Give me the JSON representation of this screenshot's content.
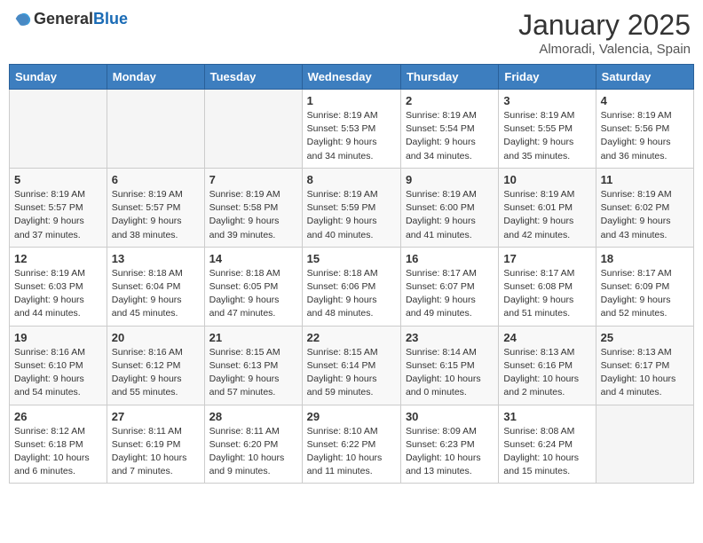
{
  "header": {
    "logo_general": "General",
    "logo_blue": "Blue",
    "month_year": "January 2025",
    "location": "Almoradi, Valencia, Spain"
  },
  "weekdays": [
    "Sunday",
    "Monday",
    "Tuesday",
    "Wednesday",
    "Thursday",
    "Friday",
    "Saturday"
  ],
  "weeks": [
    [
      {
        "day": "",
        "info": ""
      },
      {
        "day": "",
        "info": ""
      },
      {
        "day": "",
        "info": ""
      },
      {
        "day": "1",
        "info": "Sunrise: 8:19 AM\nSunset: 5:53 PM\nDaylight: 9 hours\nand 34 minutes."
      },
      {
        "day": "2",
        "info": "Sunrise: 8:19 AM\nSunset: 5:54 PM\nDaylight: 9 hours\nand 34 minutes."
      },
      {
        "day": "3",
        "info": "Sunrise: 8:19 AM\nSunset: 5:55 PM\nDaylight: 9 hours\nand 35 minutes."
      },
      {
        "day": "4",
        "info": "Sunrise: 8:19 AM\nSunset: 5:56 PM\nDaylight: 9 hours\nand 36 minutes."
      }
    ],
    [
      {
        "day": "5",
        "info": "Sunrise: 8:19 AM\nSunset: 5:57 PM\nDaylight: 9 hours\nand 37 minutes."
      },
      {
        "day": "6",
        "info": "Sunrise: 8:19 AM\nSunset: 5:57 PM\nDaylight: 9 hours\nand 38 minutes."
      },
      {
        "day": "7",
        "info": "Sunrise: 8:19 AM\nSunset: 5:58 PM\nDaylight: 9 hours\nand 39 minutes."
      },
      {
        "day": "8",
        "info": "Sunrise: 8:19 AM\nSunset: 5:59 PM\nDaylight: 9 hours\nand 40 minutes."
      },
      {
        "day": "9",
        "info": "Sunrise: 8:19 AM\nSunset: 6:00 PM\nDaylight: 9 hours\nand 41 minutes."
      },
      {
        "day": "10",
        "info": "Sunrise: 8:19 AM\nSunset: 6:01 PM\nDaylight: 9 hours\nand 42 minutes."
      },
      {
        "day": "11",
        "info": "Sunrise: 8:19 AM\nSunset: 6:02 PM\nDaylight: 9 hours\nand 43 minutes."
      }
    ],
    [
      {
        "day": "12",
        "info": "Sunrise: 8:19 AM\nSunset: 6:03 PM\nDaylight: 9 hours\nand 44 minutes."
      },
      {
        "day": "13",
        "info": "Sunrise: 8:18 AM\nSunset: 6:04 PM\nDaylight: 9 hours\nand 45 minutes."
      },
      {
        "day": "14",
        "info": "Sunrise: 8:18 AM\nSunset: 6:05 PM\nDaylight: 9 hours\nand 47 minutes."
      },
      {
        "day": "15",
        "info": "Sunrise: 8:18 AM\nSunset: 6:06 PM\nDaylight: 9 hours\nand 48 minutes."
      },
      {
        "day": "16",
        "info": "Sunrise: 8:17 AM\nSunset: 6:07 PM\nDaylight: 9 hours\nand 49 minutes."
      },
      {
        "day": "17",
        "info": "Sunrise: 8:17 AM\nSunset: 6:08 PM\nDaylight: 9 hours\nand 51 minutes."
      },
      {
        "day": "18",
        "info": "Sunrise: 8:17 AM\nSunset: 6:09 PM\nDaylight: 9 hours\nand 52 minutes."
      }
    ],
    [
      {
        "day": "19",
        "info": "Sunrise: 8:16 AM\nSunset: 6:10 PM\nDaylight: 9 hours\nand 54 minutes."
      },
      {
        "day": "20",
        "info": "Sunrise: 8:16 AM\nSunset: 6:12 PM\nDaylight: 9 hours\nand 55 minutes."
      },
      {
        "day": "21",
        "info": "Sunrise: 8:15 AM\nSunset: 6:13 PM\nDaylight: 9 hours\nand 57 minutes."
      },
      {
        "day": "22",
        "info": "Sunrise: 8:15 AM\nSunset: 6:14 PM\nDaylight: 9 hours\nand 59 minutes."
      },
      {
        "day": "23",
        "info": "Sunrise: 8:14 AM\nSunset: 6:15 PM\nDaylight: 10 hours\nand 0 minutes."
      },
      {
        "day": "24",
        "info": "Sunrise: 8:13 AM\nSunset: 6:16 PM\nDaylight: 10 hours\nand 2 minutes."
      },
      {
        "day": "25",
        "info": "Sunrise: 8:13 AM\nSunset: 6:17 PM\nDaylight: 10 hours\nand 4 minutes."
      }
    ],
    [
      {
        "day": "26",
        "info": "Sunrise: 8:12 AM\nSunset: 6:18 PM\nDaylight: 10 hours\nand 6 minutes."
      },
      {
        "day": "27",
        "info": "Sunrise: 8:11 AM\nSunset: 6:19 PM\nDaylight: 10 hours\nand 7 minutes."
      },
      {
        "day": "28",
        "info": "Sunrise: 8:11 AM\nSunset: 6:20 PM\nDaylight: 10 hours\nand 9 minutes."
      },
      {
        "day": "29",
        "info": "Sunrise: 8:10 AM\nSunset: 6:22 PM\nDaylight: 10 hours\nand 11 minutes."
      },
      {
        "day": "30",
        "info": "Sunrise: 8:09 AM\nSunset: 6:23 PM\nDaylight: 10 hours\nand 13 minutes."
      },
      {
        "day": "31",
        "info": "Sunrise: 8:08 AM\nSunset: 6:24 PM\nDaylight: 10 hours\nand 15 minutes."
      },
      {
        "day": "",
        "info": ""
      }
    ]
  ]
}
